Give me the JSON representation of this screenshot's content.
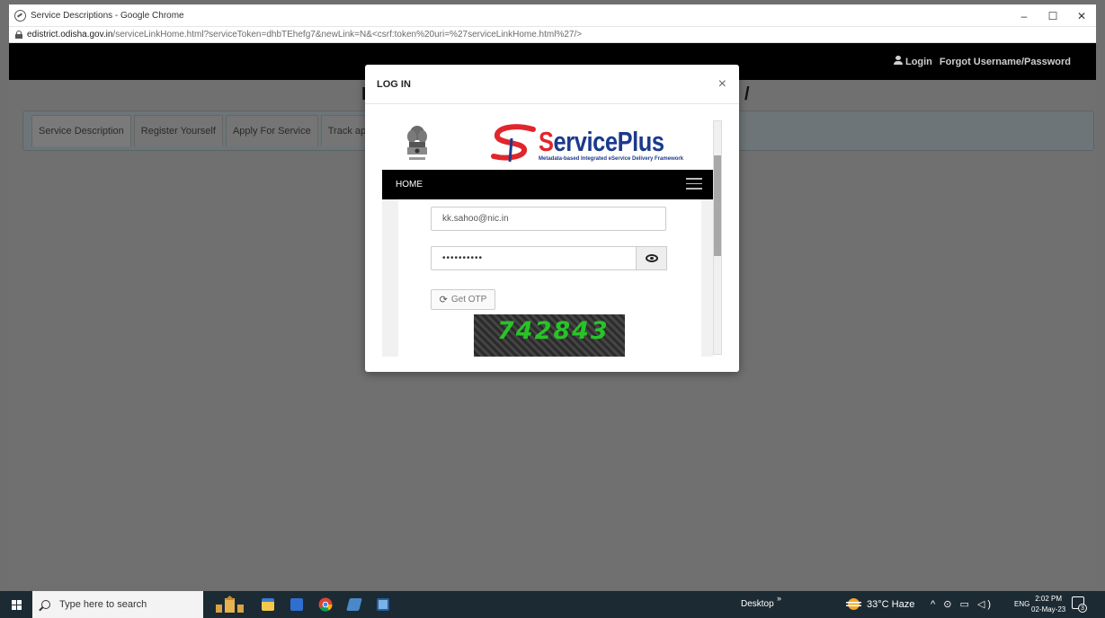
{
  "window": {
    "title": "Service Descriptions - Google Chrome",
    "minimize": "–",
    "maximize": "☐",
    "close": "✕"
  },
  "address": {
    "host": "edistrict.odisha.gov.in",
    "path": "/serviceLinkHome.html?serviceToken=dhbTEhefg7&newLink=N&<csrf:token%20uri=%27serviceLinkHome.html%27/>"
  },
  "site": {
    "login_link": "Login",
    "forgot_link": "Forgot Username/Password",
    "title_left": "I",
    "title_right": "/",
    "nav": [
      "Service Description",
      "Register Yourself",
      "Apply For Service",
      "Track ap"
    ]
  },
  "modal": {
    "title": "LOG IN",
    "close": "×",
    "brand_word_red": "S",
    "brand_word_blue": "ervicePlus",
    "brand_tagline": "Metadata-based Integrated eService Delivery Framework",
    "menu_home": "HOME",
    "email_value": "kk.sahoo@nic.in",
    "password_value": "••••••••••",
    "otp_button": "Get OTP",
    "captcha": "742843"
  },
  "taskbar": {
    "search_placeholder": "Type here to search",
    "desktop": "Desktop",
    "desktop_chev": "»",
    "weather": "33°C  Haze",
    "tray_symbols": "^ ⊙ ▭ ◁)",
    "lang": "ENG",
    "time": "2:02 PM",
    "date": "02-May-23",
    "notif_count": "3"
  },
  "colors": {
    "brand_blue": "#1b3a8c",
    "brand_red": "#e0262c",
    "captcha_green": "#27c427",
    "taskbar": "#1c2a33"
  }
}
